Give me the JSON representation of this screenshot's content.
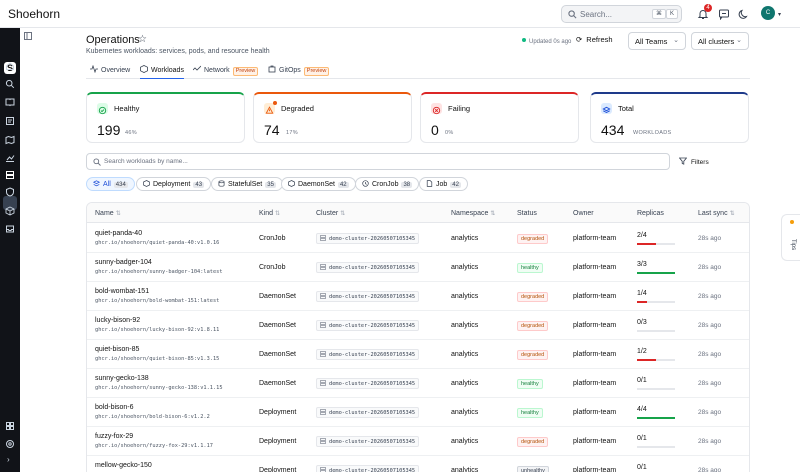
{
  "app": {
    "title": "Shoehorn"
  },
  "search": {
    "placeholder": "Search...",
    "kbd1": "⌘",
    "kbd2": "K"
  },
  "notifications": {
    "count": "4"
  },
  "user": {
    "initials": "C"
  },
  "page": {
    "title": "Operations",
    "subtitle": "Kubernetes workloads: services, pods, and resource health",
    "updated": "Updated 0s ago",
    "refresh": "Refresh",
    "team_select": "All Teams",
    "cluster_select": "All clusters"
  },
  "tabs": [
    {
      "label": "Overview",
      "icon": "activity-icon"
    },
    {
      "label": "Workloads",
      "icon": "box-icon"
    },
    {
      "label": "Network",
      "icon": "network-icon",
      "badge": "Preview"
    },
    {
      "label": "GitOps",
      "icon": "gitops-icon",
      "badge": "Preview"
    }
  ],
  "cards": [
    {
      "label": "Healthy",
      "value": "199",
      "pct": "46%",
      "color": "#16a34a",
      "icon": "check-icon"
    },
    {
      "label": "Degraded",
      "value": "74",
      "pct": "17%",
      "color": "#ea580c",
      "icon": "warning-icon"
    },
    {
      "label": "Failing",
      "value": "0",
      "pct": "0%",
      "color": "#dc2626",
      "icon": "x-circle-icon"
    },
    {
      "label": "Total",
      "value": "434",
      "pct": "WORKLOADS",
      "color": "#1e3a8a",
      "icon": "layers-icon"
    }
  ],
  "filter": {
    "placeholder": "Search workloads by name...",
    "filters_label": "Filters"
  },
  "chips": [
    {
      "label": "All",
      "count": "434"
    },
    {
      "label": "Deployment",
      "count": "43"
    },
    {
      "label": "StatefulSet",
      "count": "35"
    },
    {
      "label": "DaemonSet",
      "count": "42"
    },
    {
      "label": "CronJob",
      "count": "38"
    },
    {
      "label": "Job",
      "count": "42"
    }
  ],
  "table": {
    "headers": [
      "Name",
      "Kind",
      "Cluster",
      "Namespace",
      "Status",
      "Owner",
      "Replicas",
      "Last sync"
    ],
    "rows": [
      {
        "name": "quiet-panda-40",
        "image": "ghcr.io/shoehorn/quiet-panda-40:v1.0.16",
        "kind": "CronJob",
        "cluster": "demo-cluster-20260507105345",
        "namespace": "analytics",
        "status": "degraded",
        "owner": "platform-team",
        "replicas": "2/4",
        "ratio": 0.5,
        "sync": "28s ago"
      },
      {
        "name": "sunny-badger-104",
        "image": "ghcr.io/shoehorn/sunny-badger-104:latest",
        "kind": "CronJob",
        "cluster": "demo-cluster-20260507105345",
        "namespace": "analytics",
        "status": "healthy",
        "owner": "platform-team",
        "replicas": "3/3",
        "ratio": 1,
        "sync": "28s ago"
      },
      {
        "name": "bold-wombat-151",
        "image": "ghcr.io/shoehorn/bold-wombat-151:latest",
        "kind": "DaemonSet",
        "cluster": "demo-cluster-20260507105345",
        "namespace": "analytics",
        "status": "degraded",
        "owner": "platform-team",
        "replicas": "1/4",
        "ratio": 0.25,
        "sync": "28s ago"
      },
      {
        "name": "lucky-bison-92",
        "image": "ghcr.io/shoehorn/lucky-bison-92:v1.8.11",
        "kind": "DaemonSet",
        "cluster": "demo-cluster-20260507105345",
        "namespace": "analytics",
        "status": "degraded",
        "owner": "platform-team",
        "replicas": "0/3",
        "ratio": 0,
        "sync": "28s ago"
      },
      {
        "name": "quiet-bison-85",
        "image": "ghcr.io/shoehorn/quiet-bison-85:v1.3.15",
        "kind": "DaemonSet",
        "cluster": "demo-cluster-20260507105345",
        "namespace": "analytics",
        "status": "degraded",
        "owner": "platform-team",
        "replicas": "1/2",
        "ratio": 0.5,
        "sync": "28s ago"
      },
      {
        "name": "sunny-gecko-138",
        "image": "ghcr.io/shoehorn/sunny-gecko-138:v1.1.15",
        "kind": "DaemonSet",
        "cluster": "demo-cluster-20260507105345",
        "namespace": "analytics",
        "status": "healthy",
        "owner": "platform-team",
        "replicas": "0/1",
        "ratio": 0,
        "sync": "28s ago"
      },
      {
        "name": "bold-bison-6",
        "image": "ghcr.io/shoehorn/bold-bison-6:v1.2.2",
        "kind": "Deployment",
        "cluster": "demo-cluster-20260507105345",
        "namespace": "analytics",
        "status": "healthy",
        "owner": "platform-team",
        "replicas": "4/4",
        "ratio": 1,
        "sync": "28s ago"
      },
      {
        "name": "fuzzy-fox-29",
        "image": "ghcr.io/shoehorn/fuzzy-fox-29:v1.1.17",
        "kind": "Deployment",
        "cluster": "demo-cluster-20260507105345",
        "namespace": "analytics",
        "status": "degraded",
        "owner": "platform-team",
        "replicas": "0/1",
        "ratio": 0,
        "sync": "28s ago"
      },
      {
        "name": "mellow-gecko-150",
        "image": "",
        "kind": "Deployment",
        "cluster": "demo-cluster-20260507105345",
        "namespace": "analytics",
        "status": "unhealthy",
        "owner": "platform-team",
        "replicas": "0/1",
        "ratio": 0,
        "sync": "28s ago"
      }
    ]
  },
  "tips": {
    "label": "Tips"
  }
}
